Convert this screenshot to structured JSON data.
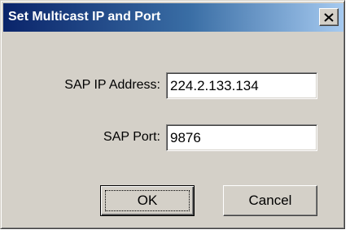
{
  "window": {
    "title": "Set Multicast IP and Port",
    "close_icon": "close-icon"
  },
  "form": {
    "sap_ip_label": "SAP IP Address:",
    "sap_ip_value": "224.2.133.134",
    "sap_port_label": "SAP Port:",
    "sap_port_value": "9876"
  },
  "buttons": {
    "ok_label": "OK",
    "cancel_label": "Cancel"
  },
  "colors": {
    "dialog_face": "#d4d0c8",
    "title_active_start": "#0a246a",
    "title_active_end": "#a6caf0"
  }
}
